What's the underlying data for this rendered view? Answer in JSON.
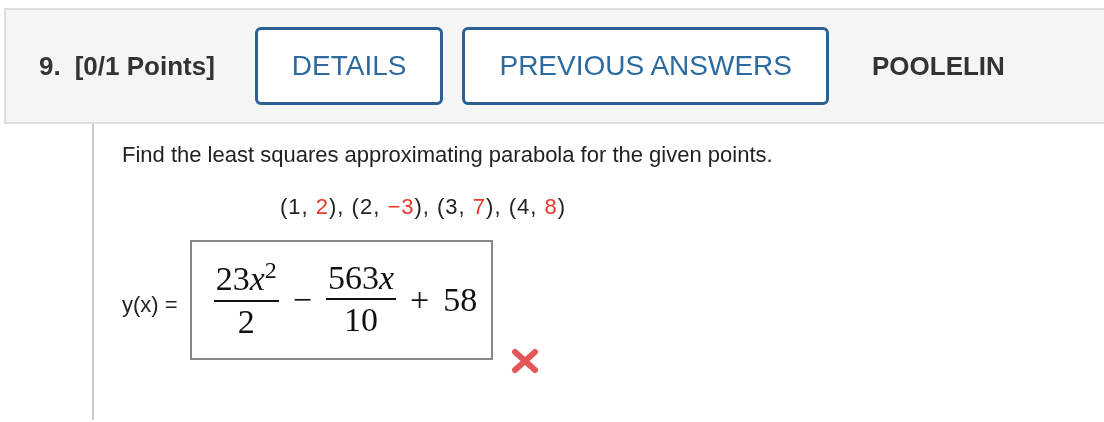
{
  "header": {
    "number": "9.",
    "points": "[0/1 Points]",
    "buttons": [
      "DETAILS",
      "PREVIOUS ANSWERS"
    ],
    "source": "POOLELIN"
  },
  "question": {
    "prompt": "Find the least squares approximating parabola for the given points.",
    "points_line": [
      {
        "kind": "plain",
        "text": "(1, "
      },
      {
        "kind": "value",
        "text": "2"
      },
      {
        "kind": "plain",
        "text": "), (2, "
      },
      {
        "kind": "value",
        "text": "−3"
      },
      {
        "kind": "plain",
        "text": "), (3, "
      },
      {
        "kind": "value",
        "text": "7"
      },
      {
        "kind": "plain",
        "text": "), (4, "
      },
      {
        "kind": "value",
        "text": "8"
      },
      {
        "kind": "plain",
        "text": ")"
      }
    ],
    "answer_label": "y(x) =",
    "answer_terms": [
      {
        "kind": "fraction",
        "coefficient": "23",
        "variable": "x",
        "exponent": "2",
        "denominator": "2"
      },
      {
        "kind": "operator",
        "text": "−"
      },
      {
        "kind": "fraction",
        "coefficient": "563",
        "variable": "x",
        "denominator": "10"
      },
      {
        "kind": "operator",
        "text": "+"
      },
      {
        "kind": "number",
        "text": "58"
      }
    ],
    "correct": false
  }
}
